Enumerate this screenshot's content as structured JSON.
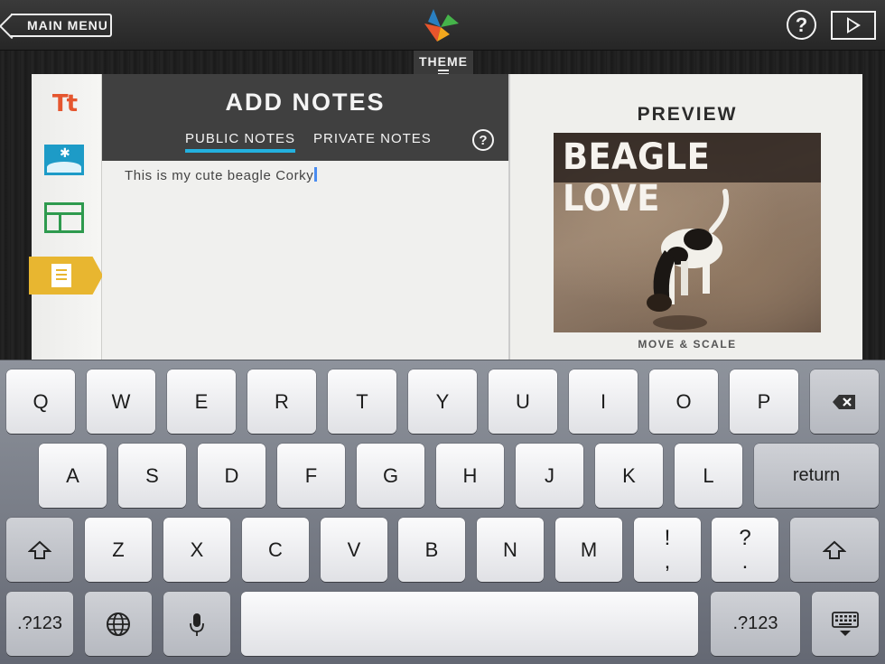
{
  "topbar": {
    "main_menu_label": "MAIN MENU",
    "theme_label": "THEME"
  },
  "sidebar": {
    "text_tool_label": "Tt"
  },
  "notes": {
    "title": "ADD NOTES",
    "tab_public": "PUBLIC NOTES",
    "tab_private": "PRIVATE NOTES",
    "help_label": "?",
    "text_value": "This is my cute beagle Corky"
  },
  "preview": {
    "title": "PREVIEW",
    "photo_caption": "BEAGLE LOVE",
    "move_scale_label": "MOVE & SCALE"
  },
  "keyboard": {
    "row1": [
      "Q",
      "W",
      "E",
      "R",
      "T",
      "Y",
      "U",
      "I",
      "O",
      "P"
    ],
    "row2": [
      "A",
      "S",
      "D",
      "F",
      "G",
      "H",
      "J",
      "K",
      "L"
    ],
    "return_label": "return",
    "row3": [
      "Z",
      "X",
      "C",
      "V",
      "B",
      "N",
      "M"
    ],
    "excl_top": "!",
    "excl_bottom": ",",
    "quest_top": "?",
    "quest_bottom": ".",
    "numbers_label": ".?123"
  },
  "colors": {
    "accent_blue": "#23b1df",
    "notes_tab_yellow": "#e8b630",
    "text_tool_orange": "#e5562f",
    "photo_tool_blue": "#1d9bc7",
    "layout_tool_green": "#2e9a4e"
  }
}
